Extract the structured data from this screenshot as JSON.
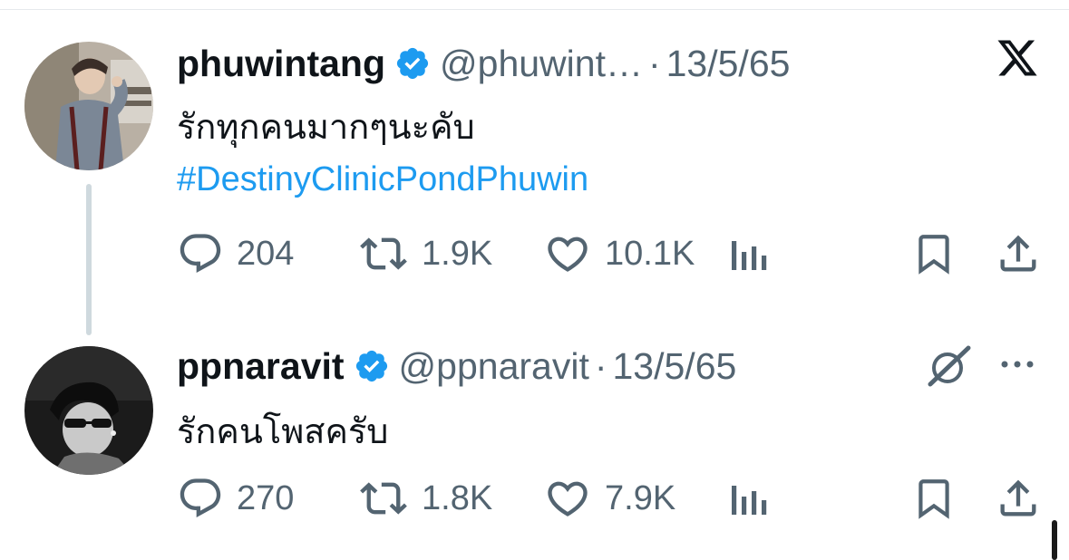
{
  "tweets": [
    {
      "display_name": "phuwintang",
      "handle": "@phuwint…",
      "separator": "·",
      "date": "13/5/65",
      "text": "รักทุกคนมากๆนะคับ",
      "hashtag": "#DestinyClinicPondPhuwin",
      "replies": "204",
      "reposts": "1.9K",
      "likes": "10.1K",
      "corner_icon": "x-logo-icon"
    },
    {
      "display_name": "ppnaravit",
      "handle": "@ppnaravit",
      "separator": "·",
      "date": "13/5/65",
      "text": "รักคนโพสครับ",
      "replies": "270",
      "reposts": "1.8K",
      "likes": "7.9K",
      "corner_icon": "grok-icon"
    }
  ],
  "colors": {
    "verified": "#1d9bf0",
    "hashtag": "#1d9bf0",
    "muted": "#536471",
    "text": "#0f1419",
    "thread_line": "#cfd9de"
  },
  "icons": [
    "reply-icon",
    "repost-icon",
    "like-icon",
    "views-icon",
    "bookmark-icon",
    "share-icon",
    "more-icon",
    "verified-badge-icon"
  ]
}
